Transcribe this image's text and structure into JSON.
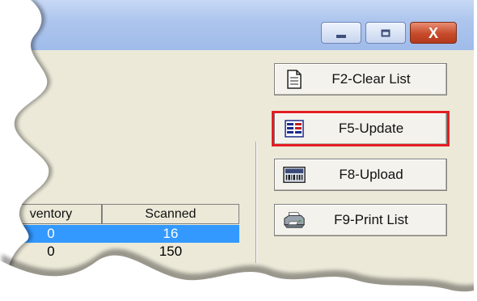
{
  "window": {
    "controls": [
      {
        "name": "minimize",
        "icon": "minimize-icon"
      },
      {
        "name": "maximize",
        "icon": "maximize-icon"
      },
      {
        "name": "close",
        "icon": "close-icon",
        "glyph": "X"
      }
    ]
  },
  "toolbar": {
    "buttons": [
      {
        "label": "F2-Clear List",
        "icon": "document-icon"
      },
      {
        "label": "F5-Update",
        "icon": "update-icon",
        "highlighted": true
      },
      {
        "label": "F8-Upload",
        "icon": "barcode-scanner-icon"
      },
      {
        "label": "F9-Print List",
        "icon": "printer-icon"
      }
    ],
    "highlight_color": "#e31e24"
  },
  "grid": {
    "columns": [
      "ventory",
      "Scanned"
    ],
    "rows": [
      {
        "inventory": "0",
        "scanned": "16",
        "selected": true
      },
      {
        "inventory": "0",
        "scanned": "150",
        "selected": false
      }
    ],
    "selection_color": "#3399ff"
  }
}
